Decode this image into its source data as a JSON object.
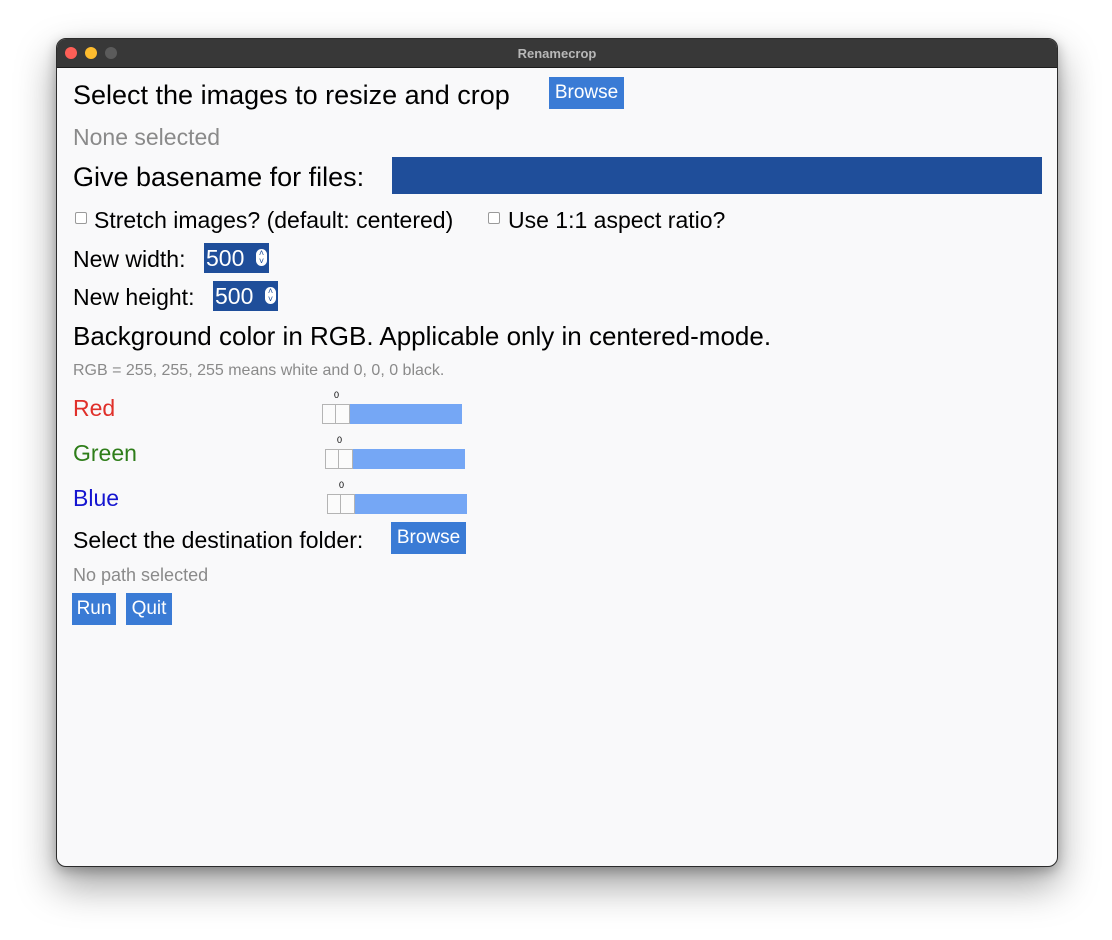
{
  "window": {
    "title": "Renamecrop"
  },
  "images": {
    "prompt": "Select the images to resize and crop",
    "browse_label": "Browse",
    "status": "None selected"
  },
  "basename": {
    "label": "Give basename for files:",
    "value": ""
  },
  "options": {
    "stretch_label": "Stretch images? (default: centered)",
    "stretch_checked": false,
    "aspect_label": "Use 1:1 aspect ratio?",
    "aspect_checked": false
  },
  "size": {
    "width_label": "New width:",
    "width_value": "500",
    "height_label": "New height:",
    "height_value": "500"
  },
  "background": {
    "title": "Background color in RGB. Applicable only in centered-mode.",
    "hint": "RGB = 255, 255, 255 means white and 0, 0, 0 black.",
    "channels": [
      {
        "label": "Red",
        "color": "#e0302a",
        "value": "0"
      },
      {
        "label": "Green",
        "color": "#2e7d19",
        "value": "0"
      },
      {
        "label": "Blue",
        "color": "#1515d0",
        "value": "0"
      }
    ]
  },
  "destination": {
    "label": "Select the destination folder:",
    "browse_label": "Browse",
    "status": "No path selected"
  },
  "actions": {
    "run_label": "Run",
    "quit_label": "Quit"
  },
  "colors": {
    "accent": "#3a7bd5",
    "input_bg": "#1f4e9a",
    "slider": "#75a7f5"
  }
}
